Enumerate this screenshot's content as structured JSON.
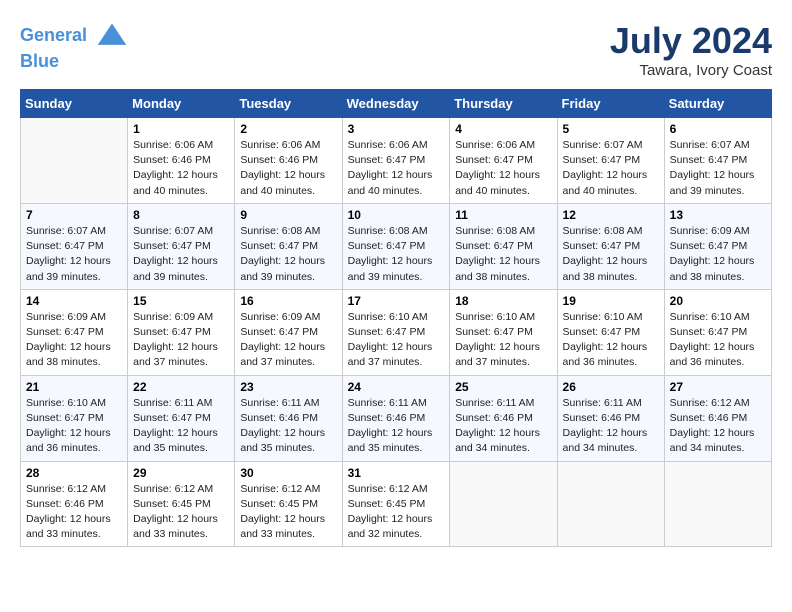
{
  "header": {
    "logo_line1": "General",
    "logo_line2": "Blue",
    "month_title": "July 2024",
    "location": "Tawara, Ivory Coast"
  },
  "days_of_week": [
    "Sunday",
    "Monday",
    "Tuesday",
    "Wednesday",
    "Thursday",
    "Friday",
    "Saturday"
  ],
  "weeks": [
    [
      {
        "day": "",
        "info": ""
      },
      {
        "day": "1",
        "info": "Sunrise: 6:06 AM\nSunset: 6:46 PM\nDaylight: 12 hours\nand 40 minutes."
      },
      {
        "day": "2",
        "info": "Sunrise: 6:06 AM\nSunset: 6:46 PM\nDaylight: 12 hours\nand 40 minutes."
      },
      {
        "day": "3",
        "info": "Sunrise: 6:06 AM\nSunset: 6:47 PM\nDaylight: 12 hours\nand 40 minutes."
      },
      {
        "day": "4",
        "info": "Sunrise: 6:06 AM\nSunset: 6:47 PM\nDaylight: 12 hours\nand 40 minutes."
      },
      {
        "day": "5",
        "info": "Sunrise: 6:07 AM\nSunset: 6:47 PM\nDaylight: 12 hours\nand 40 minutes."
      },
      {
        "day": "6",
        "info": "Sunrise: 6:07 AM\nSunset: 6:47 PM\nDaylight: 12 hours\nand 39 minutes."
      }
    ],
    [
      {
        "day": "7",
        "info": "Sunrise: 6:07 AM\nSunset: 6:47 PM\nDaylight: 12 hours\nand 39 minutes."
      },
      {
        "day": "8",
        "info": "Sunrise: 6:07 AM\nSunset: 6:47 PM\nDaylight: 12 hours\nand 39 minutes."
      },
      {
        "day": "9",
        "info": "Sunrise: 6:08 AM\nSunset: 6:47 PM\nDaylight: 12 hours\nand 39 minutes."
      },
      {
        "day": "10",
        "info": "Sunrise: 6:08 AM\nSunset: 6:47 PM\nDaylight: 12 hours\nand 39 minutes."
      },
      {
        "day": "11",
        "info": "Sunrise: 6:08 AM\nSunset: 6:47 PM\nDaylight: 12 hours\nand 38 minutes."
      },
      {
        "day": "12",
        "info": "Sunrise: 6:08 AM\nSunset: 6:47 PM\nDaylight: 12 hours\nand 38 minutes."
      },
      {
        "day": "13",
        "info": "Sunrise: 6:09 AM\nSunset: 6:47 PM\nDaylight: 12 hours\nand 38 minutes."
      }
    ],
    [
      {
        "day": "14",
        "info": "Sunrise: 6:09 AM\nSunset: 6:47 PM\nDaylight: 12 hours\nand 38 minutes."
      },
      {
        "day": "15",
        "info": "Sunrise: 6:09 AM\nSunset: 6:47 PM\nDaylight: 12 hours\nand 37 minutes."
      },
      {
        "day": "16",
        "info": "Sunrise: 6:09 AM\nSunset: 6:47 PM\nDaylight: 12 hours\nand 37 minutes."
      },
      {
        "day": "17",
        "info": "Sunrise: 6:10 AM\nSunset: 6:47 PM\nDaylight: 12 hours\nand 37 minutes."
      },
      {
        "day": "18",
        "info": "Sunrise: 6:10 AM\nSunset: 6:47 PM\nDaylight: 12 hours\nand 37 minutes."
      },
      {
        "day": "19",
        "info": "Sunrise: 6:10 AM\nSunset: 6:47 PM\nDaylight: 12 hours\nand 36 minutes."
      },
      {
        "day": "20",
        "info": "Sunrise: 6:10 AM\nSunset: 6:47 PM\nDaylight: 12 hours\nand 36 minutes."
      }
    ],
    [
      {
        "day": "21",
        "info": "Sunrise: 6:10 AM\nSunset: 6:47 PM\nDaylight: 12 hours\nand 36 minutes."
      },
      {
        "day": "22",
        "info": "Sunrise: 6:11 AM\nSunset: 6:47 PM\nDaylight: 12 hours\nand 35 minutes."
      },
      {
        "day": "23",
        "info": "Sunrise: 6:11 AM\nSunset: 6:46 PM\nDaylight: 12 hours\nand 35 minutes."
      },
      {
        "day": "24",
        "info": "Sunrise: 6:11 AM\nSunset: 6:46 PM\nDaylight: 12 hours\nand 35 minutes."
      },
      {
        "day": "25",
        "info": "Sunrise: 6:11 AM\nSunset: 6:46 PM\nDaylight: 12 hours\nand 34 minutes."
      },
      {
        "day": "26",
        "info": "Sunrise: 6:11 AM\nSunset: 6:46 PM\nDaylight: 12 hours\nand 34 minutes."
      },
      {
        "day": "27",
        "info": "Sunrise: 6:12 AM\nSunset: 6:46 PM\nDaylight: 12 hours\nand 34 minutes."
      }
    ],
    [
      {
        "day": "28",
        "info": "Sunrise: 6:12 AM\nSunset: 6:46 PM\nDaylight: 12 hours\nand 33 minutes."
      },
      {
        "day": "29",
        "info": "Sunrise: 6:12 AM\nSunset: 6:45 PM\nDaylight: 12 hours\nand 33 minutes."
      },
      {
        "day": "30",
        "info": "Sunrise: 6:12 AM\nSunset: 6:45 PM\nDaylight: 12 hours\nand 33 minutes."
      },
      {
        "day": "31",
        "info": "Sunrise: 6:12 AM\nSunset: 6:45 PM\nDaylight: 12 hours\nand 32 minutes."
      },
      {
        "day": "",
        "info": ""
      },
      {
        "day": "",
        "info": ""
      },
      {
        "day": "",
        "info": ""
      }
    ]
  ]
}
